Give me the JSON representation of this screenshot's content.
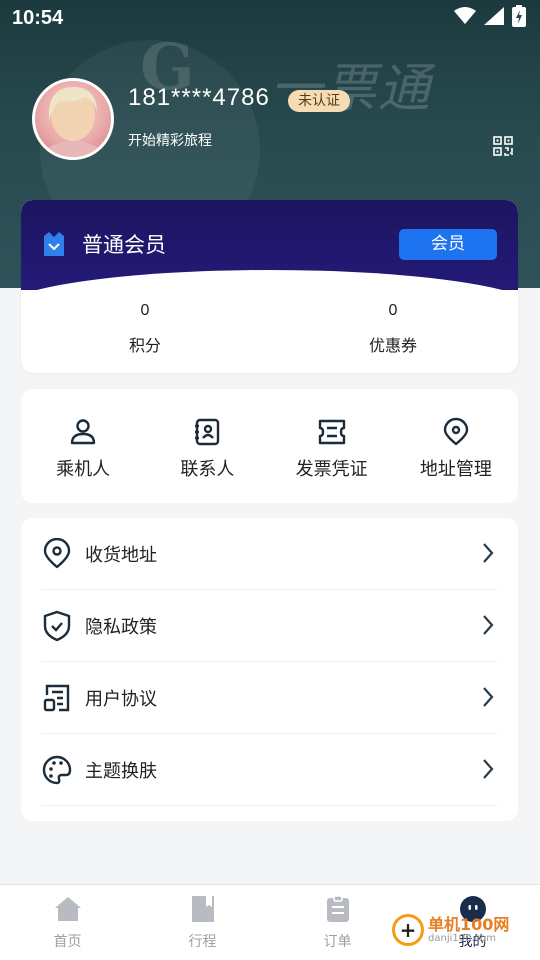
{
  "status_bar": {
    "time": "10:54"
  },
  "profile": {
    "phone": "181****4786",
    "verify_badge": "未认证",
    "subtitle": "开始精彩旅程"
  },
  "header_watermark": {
    "logo_glyph": "G",
    "logo_text": "一票通"
  },
  "member": {
    "title": "普通会员",
    "button": "会员",
    "stats": [
      {
        "value": "0",
        "label": "积分"
      },
      {
        "value": "0",
        "label": "优惠券"
      }
    ]
  },
  "quick_actions": [
    {
      "label": "乘机人",
      "icon": "user-icon"
    },
    {
      "label": "联系人",
      "icon": "contacts-book-icon"
    },
    {
      "label": "发票凭证",
      "icon": "ticket-icon"
    },
    {
      "label": "地址管理",
      "icon": "location-pin-icon"
    }
  ],
  "menu": [
    {
      "label": "收货地址",
      "icon": "location-pin-icon"
    },
    {
      "label": "隐私政策",
      "icon": "shield-check-icon"
    },
    {
      "label": "用户协议",
      "icon": "document-icon"
    },
    {
      "label": "主题换肤",
      "icon": "palette-icon"
    }
  ],
  "tabs": [
    {
      "label": "首页",
      "icon": "home-icon"
    },
    {
      "label": "行程",
      "icon": "bookmark-icon"
    },
    {
      "label": "订单",
      "icon": "clipboard-icon"
    },
    {
      "label": "我的",
      "icon": "profile-face-icon",
      "active": true
    }
  ],
  "watermark": {
    "text": "单机100网",
    "sub": "danji100.com"
  },
  "colors": {
    "header_bg": "#274a4f",
    "member_bg": "#1c1560",
    "member_button": "#1e73f0",
    "badge_bg": "#f6dcb4",
    "icon_dark": "#1b2c3a"
  }
}
